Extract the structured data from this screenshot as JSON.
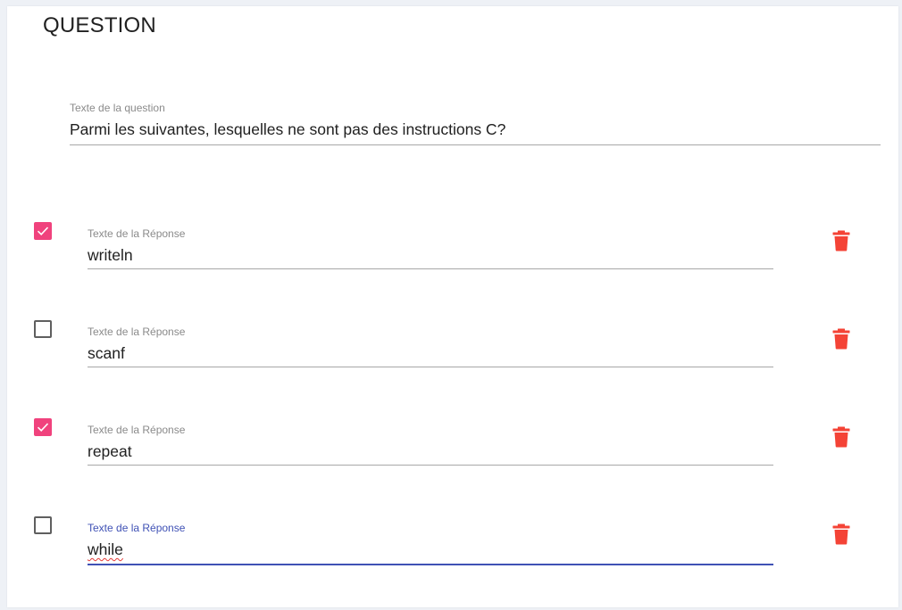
{
  "card": {
    "title": "QUESTION"
  },
  "question": {
    "label": "Texte de la question",
    "value": "Parmi les suivantes, lesquelles ne sont pas des instructions C?"
  },
  "answers": [
    {
      "label": "Texte de la Réponse",
      "value": "writeln",
      "checked": true,
      "focused": false
    },
    {
      "label": "Texte de la Réponse",
      "value": "scanf",
      "checked": false,
      "focused": false
    },
    {
      "label": "Texte de la Réponse",
      "value": "repeat",
      "checked": true,
      "focused": false
    },
    {
      "label": "Texte de la Réponse",
      "value": "while",
      "checked": false,
      "focused": true
    }
  ],
  "colors": {
    "checkbox_checked": "#f0427d",
    "delete_icon": "#f44336",
    "focus_accent": "#3f51b5"
  },
  "icons": {
    "delete": "trash-icon",
    "check": "checkmark-icon"
  }
}
